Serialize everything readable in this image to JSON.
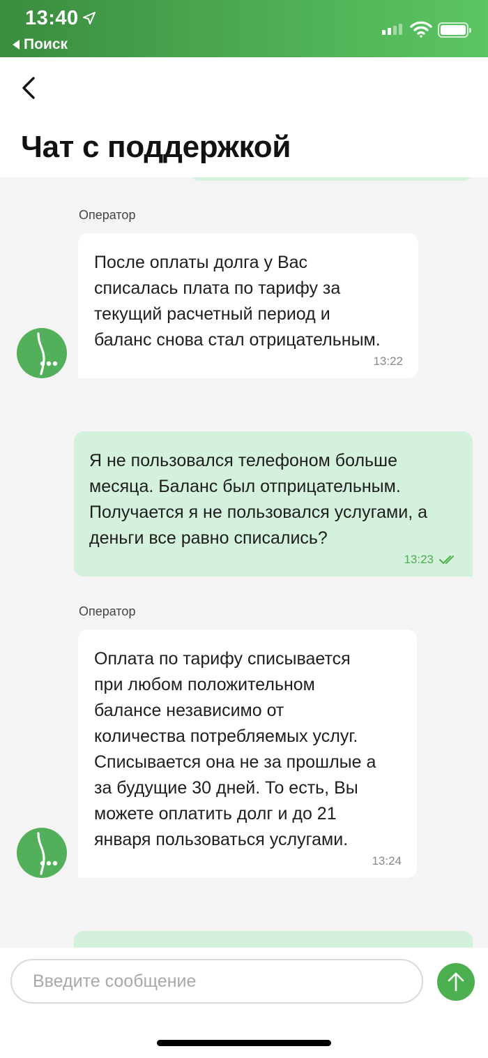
{
  "status_bar": {
    "time": "13:40",
    "back_app": "Поиск"
  },
  "header": {
    "title": "Чат с поддержкой"
  },
  "messages": [
    {
      "from": "operator",
      "sender": "Оператор",
      "text": "После оплаты долга у Вас\nсписалась плата по тарифу за\nтекущий расчетный период и\nбаланс снова стал отрицательным.",
      "time": "13:22"
    },
    {
      "from": "user",
      "text": "Я не пользовался телефоном больше\nмесяца. Баланс был отприцательным.\nПолучается я не пользовался услугами, а\nденьги все равно списались?",
      "time": "13:23",
      "status": "read"
    },
    {
      "from": "operator",
      "sender": "Оператор",
      "text": "Оплата по тарифу списывается\nпри любом положительном\nбалансе независимо от\nколичества потребляемых услуг.\nСписывается она не за прошлые а\nза будущие 30 дней. То есть, Вы\nможете оплатить долг и до 21\nянваря пользоваться услугами.",
      "time": "13:24"
    }
  ],
  "composer": {
    "placeholder": "Введите сообщение",
    "value": ""
  },
  "colors": {
    "brand": "#4caf50",
    "user_bubble": "#d3f1dc",
    "operator_bubble": "#ffffff",
    "background": "#f4f4f4"
  },
  "icons": {
    "back": "chevron-left-icon",
    "send": "arrow-up-icon",
    "avatar": "megafon-logo-icon"
  }
}
